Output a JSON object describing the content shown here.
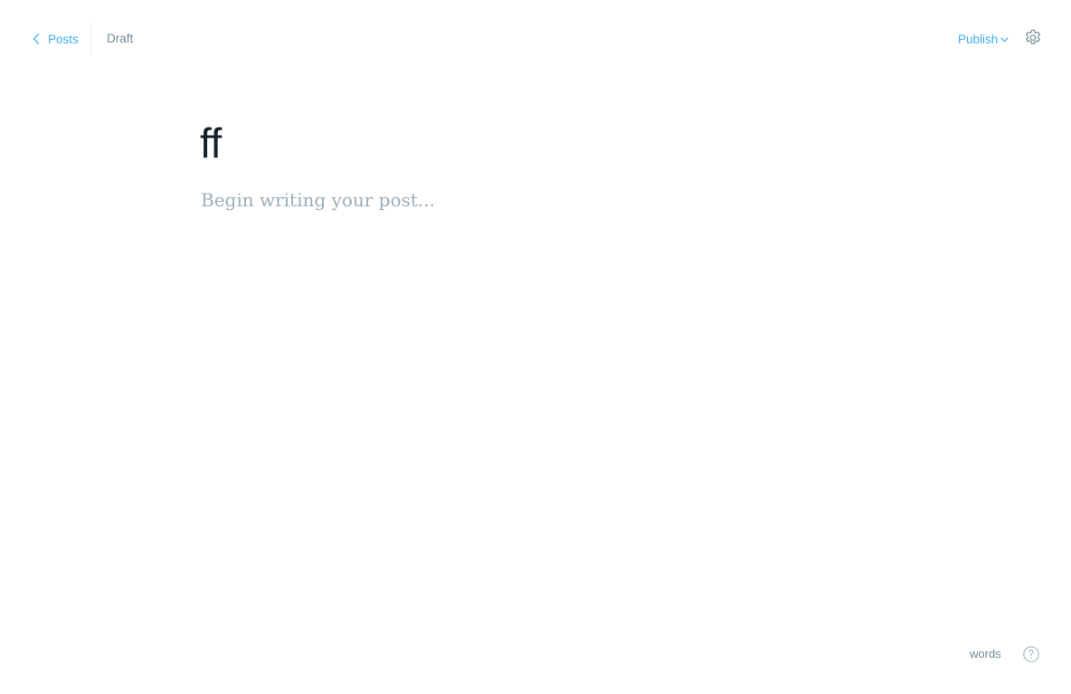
{
  "header": {
    "back_label": "Posts",
    "status": "Draft",
    "publish_label": "Publish"
  },
  "editor": {
    "title": "ff",
    "body_placeholder": "Begin writing your post..."
  },
  "footer": {
    "word_count_label": "words"
  },
  "icons": {
    "back": "chevron-left-icon",
    "publish_menu": "chevron-down-icon",
    "settings": "gear-icon",
    "help": "question-circle-icon"
  },
  "colors": {
    "accent": "#3eb0ef",
    "muted": "#738a94",
    "placeholder": "#9baeb8",
    "title": "#15212a"
  }
}
